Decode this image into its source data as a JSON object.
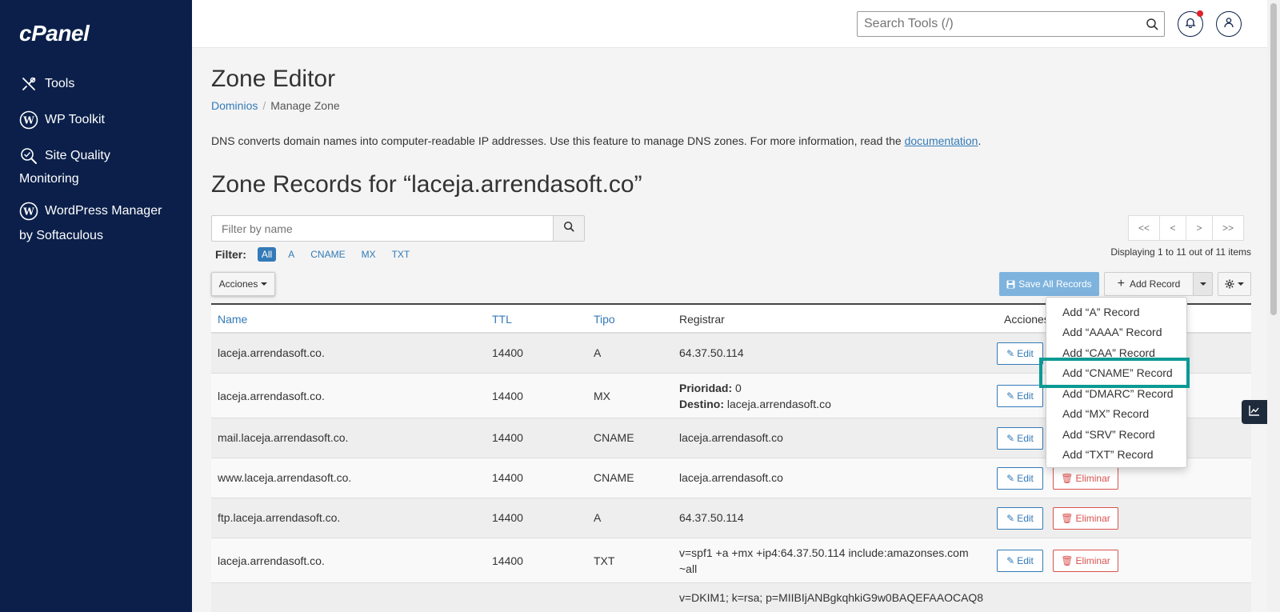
{
  "app": {
    "logo": "cPanel"
  },
  "sidebar": {
    "items": [
      {
        "label": "Tools",
        "icon": "tools-icon"
      },
      {
        "label": "WP Toolkit",
        "icon": "wordpress-icon"
      },
      {
        "label": "Site Quality",
        "label2": "Monitoring",
        "icon": "site-quality-icon"
      },
      {
        "label": "WordPress Manager",
        "label2": "by Softaculous",
        "icon": "wordpress-icon"
      }
    ]
  },
  "header": {
    "search_placeholder": "Search Tools (/)"
  },
  "page": {
    "title": "Zone Editor",
    "breadcrumb": {
      "link": "Dominios",
      "current": "Manage Zone"
    },
    "description": "DNS converts domain names into computer-readable IP addresses. Use this feature to manage DNS zones. For more information, read the ",
    "description_link": "documentation",
    "description_end": ".",
    "zone_title": "Zone Records for “laceja.arrendasoft.co”"
  },
  "filter": {
    "placeholder": "Filter by name",
    "label": "Filter:",
    "chips": [
      "All",
      "A",
      "CNAME",
      "MX",
      "TXT"
    ],
    "active": "All"
  },
  "pager": {
    "buttons": [
      "<<",
      "<",
      ">",
      ">>"
    ],
    "info": "Displaying 1 to 11 out of 11 items"
  },
  "toolbar": {
    "acciones": "Acciones",
    "save_all": "Save All Records",
    "add_record": "Add Record"
  },
  "table": {
    "headers": {
      "name": "Name",
      "ttl": "TTL",
      "tipo": "Tipo",
      "registrar": "Registrar",
      "acciones": "Acciones"
    },
    "edit_label": "Edit",
    "delete_label": "Eliminar",
    "rows": [
      {
        "name": "laceja.arrendasoft.co.",
        "ttl": "14400",
        "type": "A",
        "record": "64.37.50.114"
      },
      {
        "name": "laceja.arrendasoft.co.",
        "ttl": "14400",
        "type": "MX",
        "prioridad_label": "Prioridad:",
        "prioridad": "0",
        "destino_label": "Destino:",
        "destino": "laceja.arrendasoft.co"
      },
      {
        "name": "mail.laceja.arrendasoft.co.",
        "ttl": "14400",
        "type": "CNAME",
        "record": "laceja.arrendasoft.co"
      },
      {
        "name": "www.laceja.arrendasoft.co.",
        "ttl": "14400",
        "type": "CNAME",
        "record": "laceja.arrendasoft.co"
      },
      {
        "name": "ftp.laceja.arrendasoft.co.",
        "ttl": "14400",
        "type": "A",
        "record": "64.37.50.114"
      },
      {
        "name": "laceja.arrendasoft.co.",
        "ttl": "14400",
        "type": "TXT",
        "record_line1": "v=spf1 +a +mx +ip4:64.37.50.114 include:amazonses.com",
        "record_line2": "~all"
      },
      {
        "record_partial": "v=DKIM1; k=rsa; p=MIIBIjANBgkqhkiG9w0BAQEFAAOCAQ8"
      }
    ]
  },
  "dropdown": {
    "items": [
      "Add “A” Record",
      "Add “AAAA” Record",
      "Add “CAA” Record",
      "Add “CNAME” Record",
      "Add “DMARC” Record",
      "Add “MX” Record",
      "Add “SRV” Record",
      "Add “TXT” Record"
    ],
    "highlighted": "Add “CNAME” Record"
  },
  "colors": {
    "sidebar_bg": "#0b1f4a",
    "link": "#337ab7",
    "danger": "#d9534f",
    "highlight": "#0b9a94"
  }
}
